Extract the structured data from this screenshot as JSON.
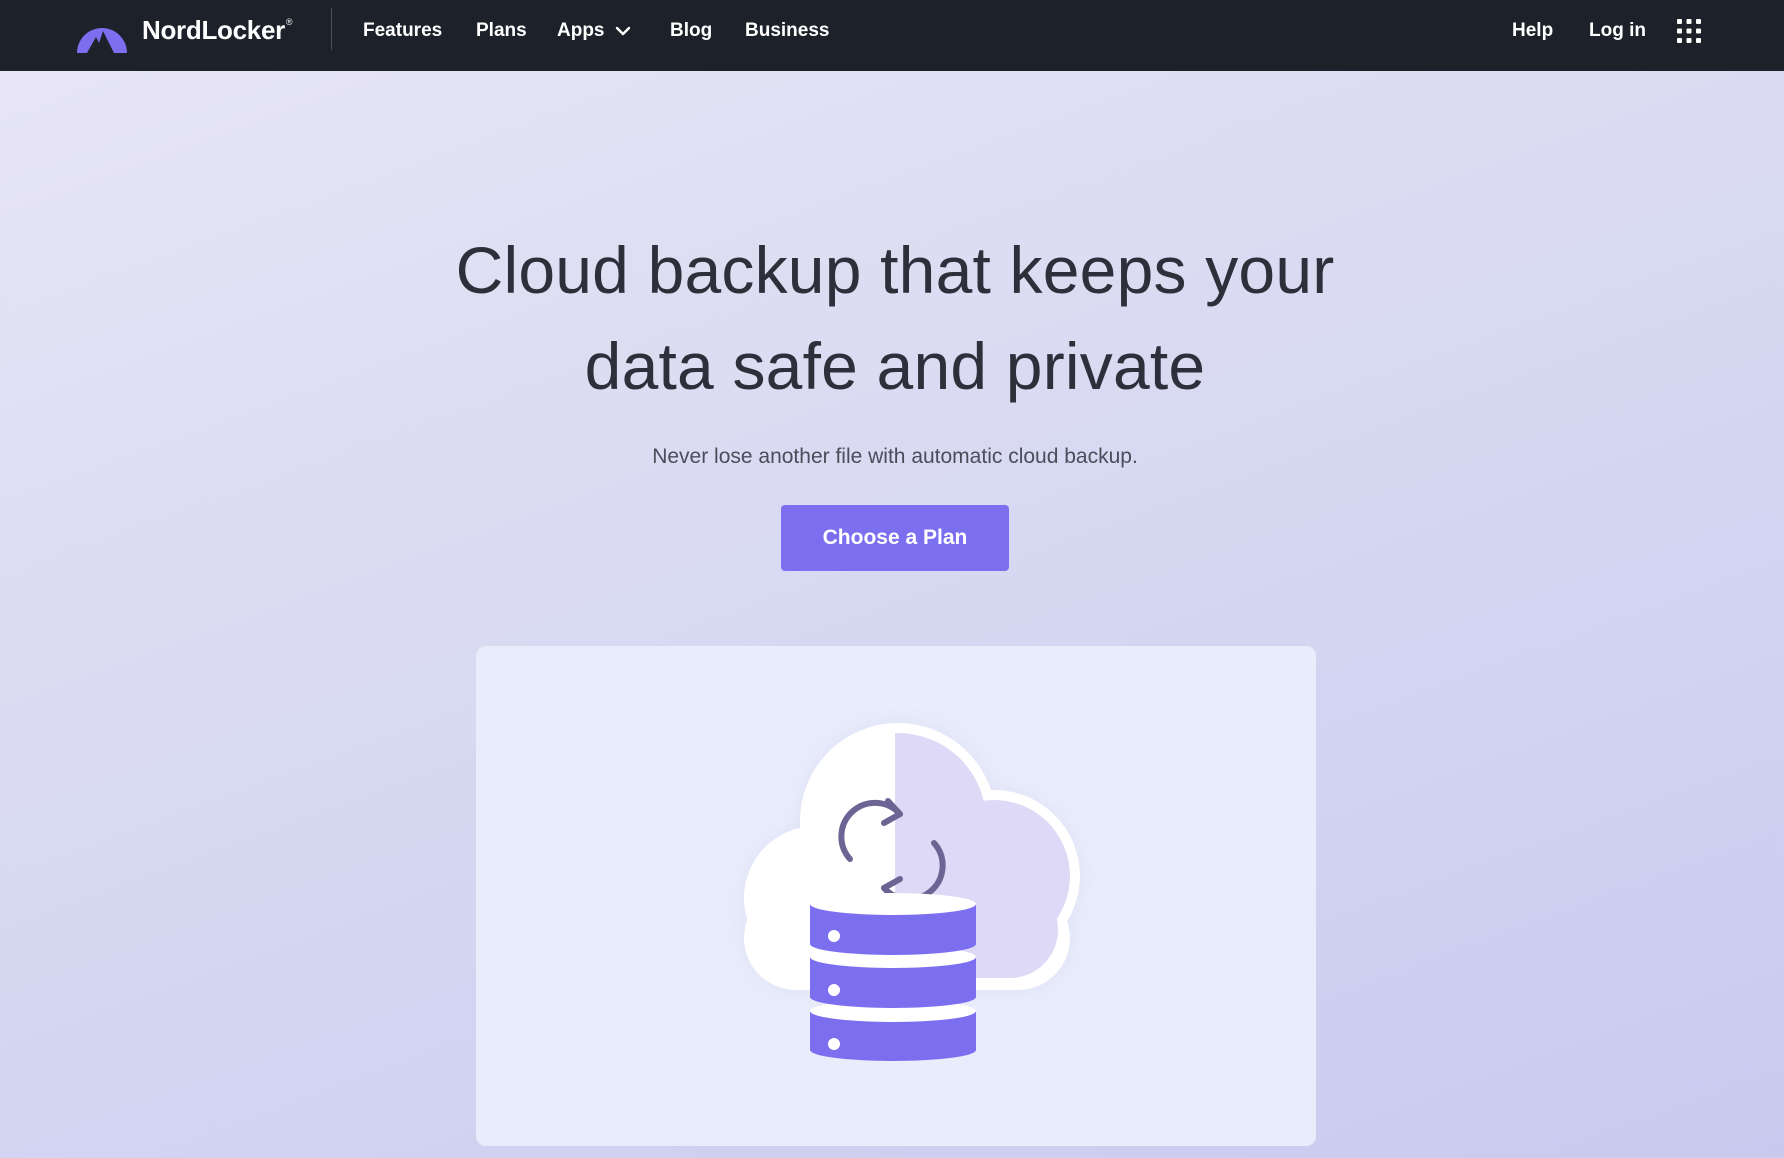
{
  "brand": {
    "name": "NordLocker",
    "registered_mark": "®",
    "accent_color": "#7b6ff0",
    "nav_background": "#1d222a"
  },
  "nav": {
    "features": "Features",
    "plans": "Plans",
    "apps": "Apps",
    "blog": "Blog",
    "business": "Business",
    "help": "Help",
    "login": "Log in"
  },
  "hero": {
    "title_line1": "Cloud backup that keeps your",
    "title_line2": "data safe and private",
    "subtitle": "Never lose another file with automatic cloud backup.",
    "cta_label": "Choose a Plan"
  },
  "icons": {
    "logo": "mountain-logo-icon",
    "apps_dropdown": "chevron-down-icon",
    "app_launcher": "grid-icon",
    "illustration": "cloud-database-sync-icon"
  }
}
